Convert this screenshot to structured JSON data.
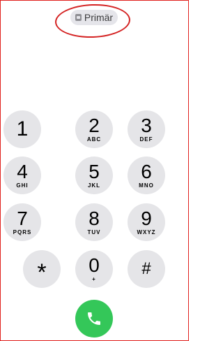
{
  "sim": {
    "label": "Primär",
    "icon": "sim-card-icon"
  },
  "keypad": {
    "keys": [
      {
        "digit": "1",
        "letters": ""
      },
      {
        "digit": "2",
        "letters": "ABC"
      },
      {
        "digit": "3",
        "letters": "DEF"
      },
      {
        "digit": "4",
        "letters": "GHI"
      },
      {
        "digit": "5",
        "letters": "JKL"
      },
      {
        "digit": "6",
        "letters": "MNO"
      },
      {
        "digit": "7",
        "letters": "PQRS"
      },
      {
        "digit": "8",
        "letters": "TUV"
      },
      {
        "digit": "9",
        "letters": "WXYZ"
      },
      {
        "digit": "*",
        "letters": ""
      },
      {
        "digit": "0",
        "letters": "+"
      },
      {
        "digit": "#",
        "letters": ""
      }
    ]
  },
  "call": {
    "icon": "phone-icon",
    "color": "#34c759"
  },
  "colors": {
    "key_background": "#e5e5e8",
    "frame_border": "#e0201c",
    "annotation_circle": "#d42222"
  }
}
